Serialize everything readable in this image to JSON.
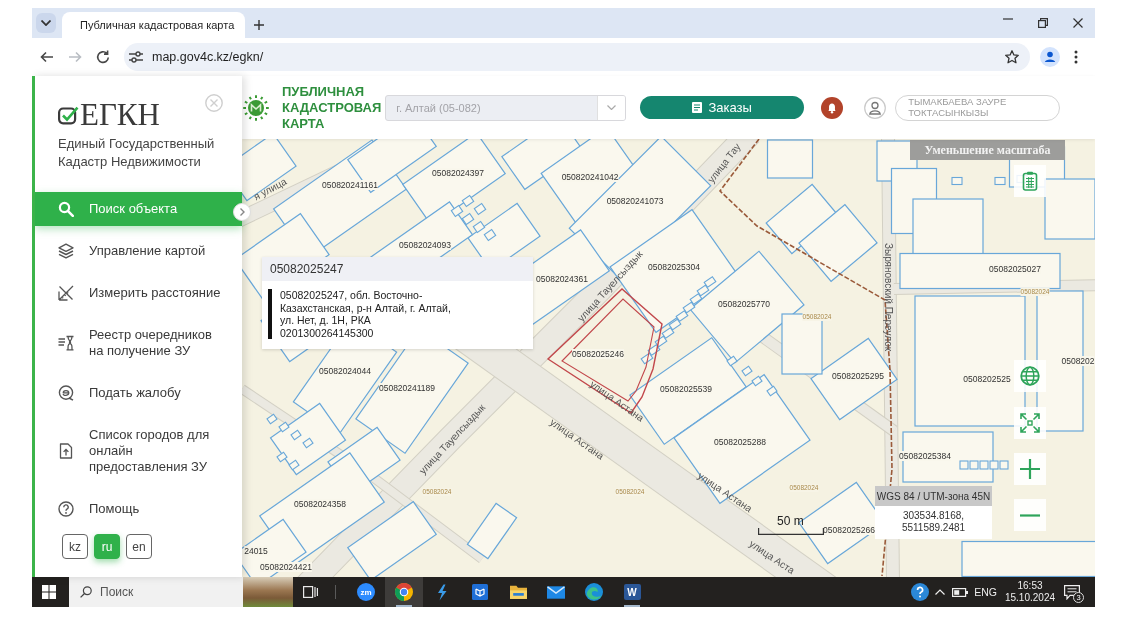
{
  "browser": {
    "tabs": [
      {
        "title": "Публичная кадастровая карта",
        "selected": true
      }
    ],
    "nav": [
      {
        "kind": "back",
        "disabled": false
      },
      {
        "kind": "forward",
        "disabled": true
      },
      {
        "kind": "reload",
        "disabled": false
      }
    ],
    "url": "map.gov4c.kz/egkn/"
  },
  "sidebar": {
    "logo": "ЕГКН",
    "subtitle": "Единый Государственный Кадастр Недвижимости",
    "items": [
      {
        "kind": "search",
        "label": "Поиск объекта",
        "selected": true
      },
      {
        "kind": "layers",
        "label": "Управление картой",
        "selected": false
      },
      {
        "kind": "measure",
        "label": "Измерить расстояние",
        "selected": false
      },
      {
        "kind": "queue",
        "label": "Реестр очередников на получение ЗУ",
        "selected": false
      },
      {
        "kind": "complaint",
        "label": "Подать жалобу",
        "selected": false
      },
      {
        "kind": "cities",
        "label": "Список городов для онлайн предоставления ЗУ",
        "selected": false
      },
      {
        "kind": "help",
        "label": "Помощь",
        "selected": false
      }
    ],
    "languages": [
      {
        "label": "kz",
        "selected": false
      },
      {
        "label": "ru",
        "selected": true
      },
      {
        "label": "en",
        "selected": false
      }
    ]
  },
  "header": {
    "title": "ПУБЛИЧНАЯ КАДАСТРОВАЯ КАРТА",
    "region_select": {
      "placeholder": "г. Алтай (05-082)"
    },
    "orders_button": "Заказы",
    "user_name": "ТЫМАКБАЕВА ЗАУРЕ ТОКТАСЫНКЫЗЫ"
  },
  "map": {
    "tooltip": "Уменьшение масштаба",
    "labels": [
      {
        "text": "я улица",
        "kind": "street"
      },
      {
        "text": "05082024397",
        "kind": "parcel"
      },
      {
        "text": "050820241042",
        "kind": "parcel"
      },
      {
        "text": "050820241161",
        "kind": "parcel"
      },
      {
        "text": "050820241073",
        "kind": "parcel"
      },
      {
        "text": "улица Тау",
        "kind": "street"
      },
      {
        "text": "05082024093",
        "kind": "parcel"
      },
      {
        "text": "05082024361",
        "kind": "parcel"
      },
      {
        "text": "05082025304",
        "kind": "parcel"
      },
      {
        "text": "05082025027",
        "kind": "parcel"
      },
      {
        "text": "улица Тауелсыздык",
        "kind": "street"
      },
      {
        "text": "05082025770",
        "kind": "parcel"
      },
      {
        "text": "Зыряновский Переулок",
        "kind": "street"
      },
      {
        "text": "05082024",
        "kind": "faint"
      },
      {
        "text": "05082025246",
        "kind": "parcel"
      },
      {
        "text": "05082024044",
        "kind": "parcel"
      },
      {
        "text": "050820241189",
        "kind": "parcel"
      },
      {
        "text": "05082025539",
        "kind": "parcel"
      },
      {
        "text": "05082025295",
        "kind": "parcel"
      },
      {
        "text": "0508202525",
        "kind": "parcel"
      },
      {
        "text": "0508202",
        "kind": "parcel"
      },
      {
        "text": "улица Тауелсыздык",
        "kind": "street"
      },
      {
        "text": "улица Астана",
        "kind": "street"
      },
      {
        "text": "улица Астана",
        "kind": "street"
      },
      {
        "text": "05082025288",
        "kind": "parcel"
      },
      {
        "text": "05082025384",
        "kind": "parcel"
      },
      {
        "text": "улица Астана",
        "kind": "street"
      },
      {
        "text": "05082024",
        "kind": "faint"
      },
      {
        "text": "05082024",
        "kind": "faint"
      },
      {
        "text": "05082024",
        "kind": "faint"
      },
      {
        "text": "05082025266",
        "kind": "parcel"
      },
      {
        "text": "05082024358",
        "kind": "parcel"
      },
      {
        "text": "улица Аста",
        "kind": "street"
      },
      {
        "text": "24015",
        "kind": "parcel"
      },
      {
        "text": "05082024421",
        "kind": "parcel"
      },
      {
        "text": "05082024",
        "kind": "faint"
      }
    ],
    "popup": {
      "title": "05082025247",
      "address": "05082025247, обл. Восточно-Казахстанская, р-н Алтай, г. Алтай, ул. Нет, д. 1Н, РКА",
      "code": "0201300264145300"
    },
    "coordinates": {
      "system": "WGS 84 / UTM-зона 45N",
      "easting": "303534.8168,",
      "northing": "5511589.2481"
    },
    "scale": "50 m",
    "controls": [
      {
        "kind": "report"
      },
      {
        "kind": "globe"
      },
      {
        "kind": "fullscreen"
      },
      {
        "kind": "zoom_in"
      },
      {
        "kind": "zoom_out"
      }
    ]
  },
  "taskbar": {
    "search": {
      "placeholder": "Поиск"
    },
    "apps": [
      {
        "kind": "zoom",
        "label": "zm",
        "selected": false,
        "open": false
      },
      {
        "kind": "chrome",
        "selected": true,
        "open": true
      },
      {
        "kind": "lightning",
        "selected": false,
        "open": false
      },
      {
        "kind": "store",
        "selected": false,
        "open": false
      },
      {
        "kind": "explorer",
        "selected": false,
        "open": false
      },
      {
        "kind": "mail",
        "selected": false,
        "open": false
      },
      {
        "kind": "edge",
        "selected": false,
        "open": false
      },
      {
        "kind": "word",
        "label": "W",
        "selected": false,
        "open": true
      }
    ],
    "tray": {
      "language": "ENG",
      "time": "16:53",
      "date": "15.10.2024",
      "notifications": "3"
    }
  }
}
